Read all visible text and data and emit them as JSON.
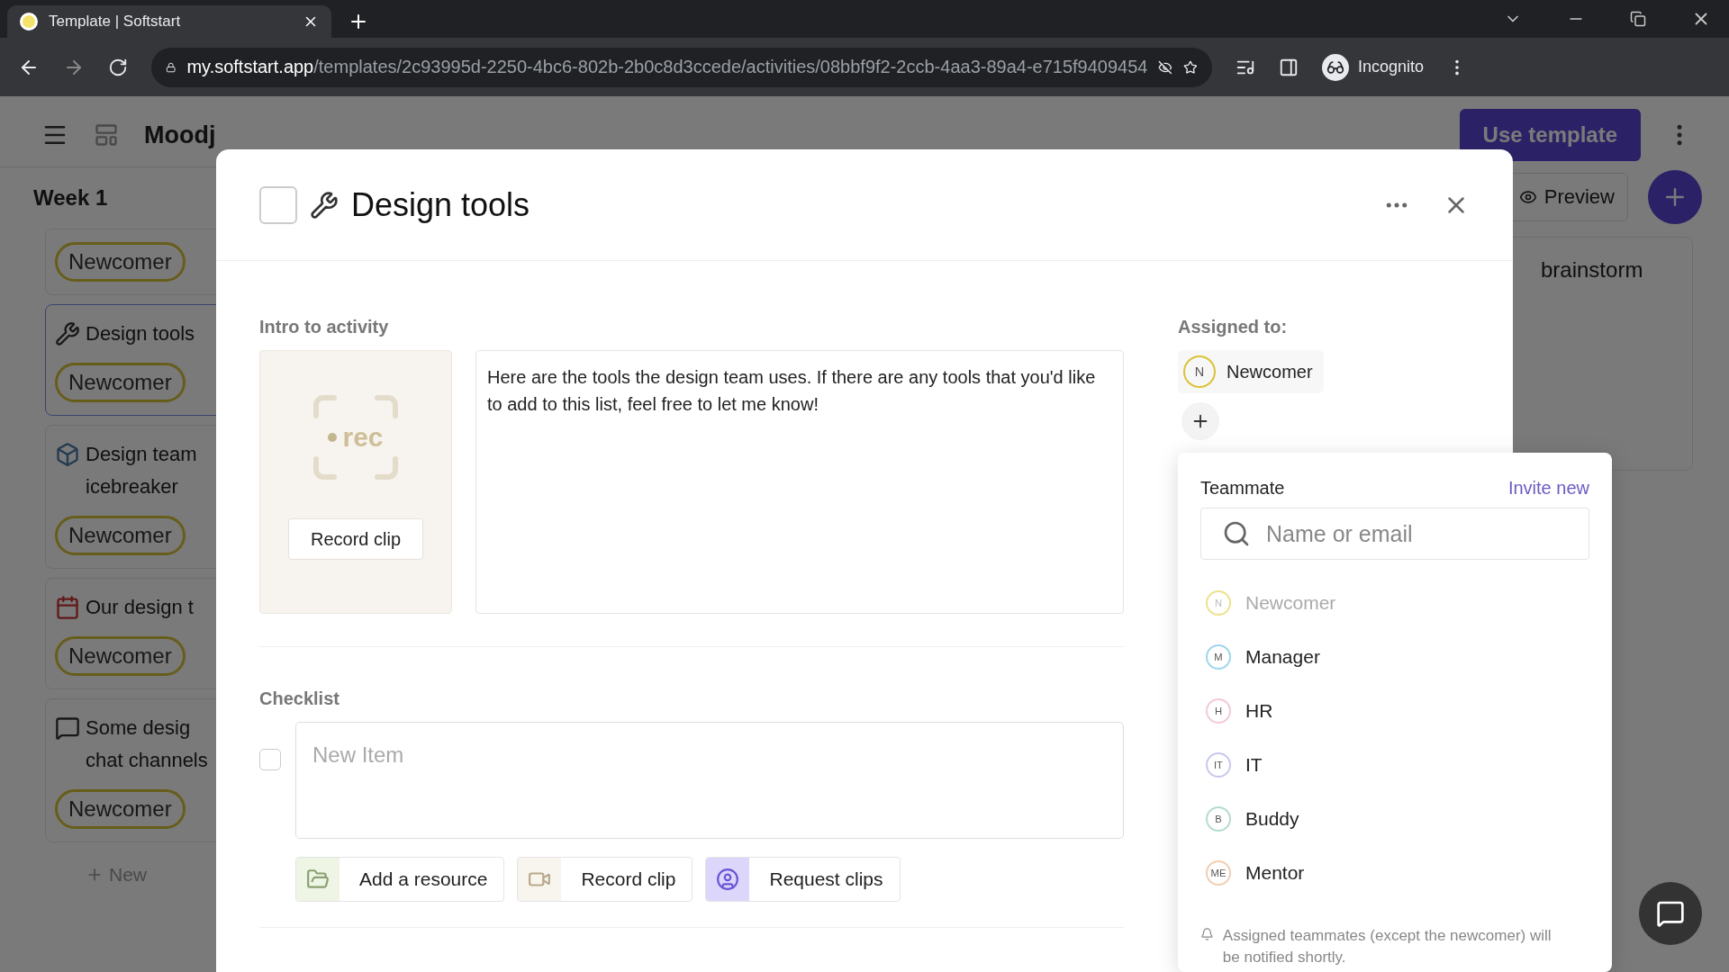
{
  "browser": {
    "tab_title": "Template | Softstart",
    "url_host": "my.softstart.app",
    "url_path": "/templates/2c93995d-2250-4bc6-802b-2b0c8d3ccede/activities/08bbf9f2-2ccb-4aa3-89a4-e715f9409454",
    "profile": "Incognito"
  },
  "page": {
    "title": "Moodj",
    "use_template": "Use template",
    "week": "Week 1",
    "preview": "Preview",
    "new": "New",
    "cards": [
      {
        "kind": "tag-only",
        "tag": "Newcomer",
        "selected": false
      },
      {
        "kind": "tools",
        "title_lines": [
          "Design tools"
        ],
        "tag": "Newcomer",
        "selected": true
      },
      {
        "kind": "cube",
        "title_lines": [
          "Design team",
          "icebreaker"
        ],
        "tag": "Newcomer",
        "selected": false
      },
      {
        "kind": "calendar",
        "title_lines": [
          "Our design t"
        ],
        "tag": "Newcomer",
        "selected": false
      },
      {
        "kind": "chat",
        "title_lines": [
          "Some desig",
          "chat channels"
        ],
        "tag": "Newcomer",
        "selected": false
      }
    ],
    "right_cards": [
      {
        "title": "brainstorm"
      }
    ]
  },
  "modal": {
    "title": "Design tools",
    "done": false,
    "intro_label": "Intro to activity",
    "rec_label": "rec",
    "record_clip": "Record clip",
    "intro_text": "Here are the tools the design team uses. If there are any tools that you'd like to add to this list, feel free to let me know!",
    "checklist_label": "Checklist",
    "checklist_items": [
      {
        "placeholder": "New Item",
        "checked": false
      }
    ],
    "actions": [
      {
        "kind": "resource",
        "label": "Add a resource"
      },
      {
        "kind": "clip",
        "label": "Record clip"
      },
      {
        "kind": "request",
        "label": "Request clips"
      }
    ],
    "assigned_label": "Assigned to:",
    "assignees": [
      {
        "initials": "N",
        "name": "Newcomer",
        "color": "#dcc23a"
      }
    ]
  },
  "dropdown": {
    "heading": "Teammate",
    "invite": "Invite new",
    "search_placeholder": "Name or email",
    "options": [
      {
        "initials": "N",
        "name": "Newcomer",
        "color": "#ece28e",
        "disabled": true
      },
      {
        "initials": "M",
        "name": "Manager",
        "color": "#9fd6ea",
        "disabled": false
      },
      {
        "initials": "H",
        "name": "HR",
        "color": "#f2c9dc",
        "disabled": false
      },
      {
        "initials": "IT",
        "name": "IT",
        "color": "#c8c8f0",
        "disabled": false
      },
      {
        "initials": "B",
        "name": "Buddy",
        "color": "#b4dccf",
        "disabled": false
      },
      {
        "initials": "ME",
        "name": "Mentor",
        "color": "#f0cfb4",
        "disabled": false
      }
    ],
    "note": "Assigned teammates (except the newcomer) will be notified shortly."
  }
}
